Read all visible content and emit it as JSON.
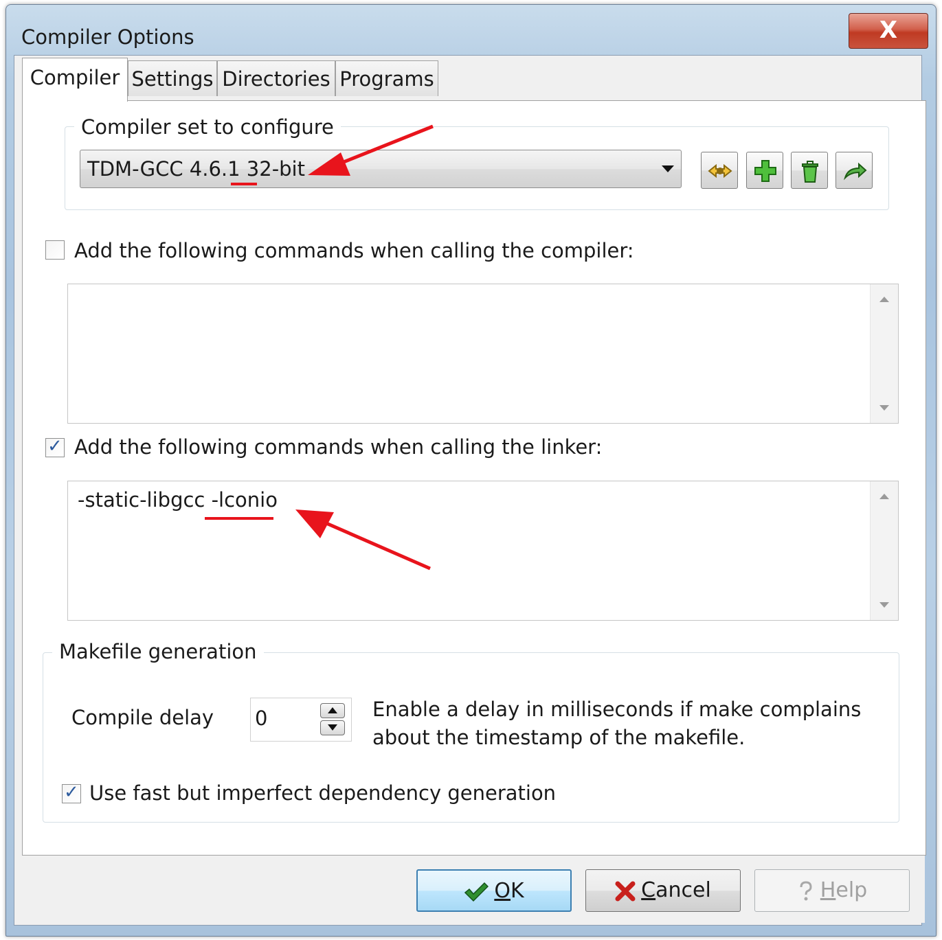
{
  "window": {
    "title": "Compiler Options",
    "close_label": "X"
  },
  "tabs": [
    {
      "label": "Compiler",
      "active": true
    },
    {
      "label": "Settings",
      "active": false
    },
    {
      "label": "Directories",
      "active": false
    },
    {
      "label": "Programs",
      "active": false
    }
  ],
  "compiler_set": {
    "group_label": "Compiler set to configure",
    "selected": "TDM-GCC 4.6.1 32-bit",
    "toolbar_icons": [
      "find-compilers-icon",
      "add-compiler-icon",
      "delete-compiler-icon",
      "rename-compiler-icon"
    ]
  },
  "compiler_commands": {
    "checked": false,
    "label": "Add the following commands when calling the compiler:",
    "value": ""
  },
  "linker_commands": {
    "checked": true,
    "label": "Add the following commands when calling the linker:",
    "value": "-static-libgcc -lconio"
  },
  "makefile": {
    "group_label": "Makefile generation",
    "compile_delay_label": "Compile delay",
    "compile_delay_value": "0",
    "delay_help_line1": "Enable a delay in milliseconds if make complains",
    "delay_help_line2": "about the timestamp of the makefile.",
    "fast_dependency_checked": true,
    "fast_dependency_label": "Use fast but imperfect dependency generation"
  },
  "buttons": {
    "ok_label": "OK",
    "ok_mnemonic": "O",
    "ok_rest": "K",
    "cancel_mnemonic": "C",
    "cancel_rest": "ancel",
    "help_mnemonic": "H",
    "help_rest": "elp"
  },
  "colors": {
    "annotation_red": "#e8141c",
    "ok_green": "#2f8f2f",
    "cancel_red": "#c8201c",
    "title_bar": "#b3cce3"
  }
}
